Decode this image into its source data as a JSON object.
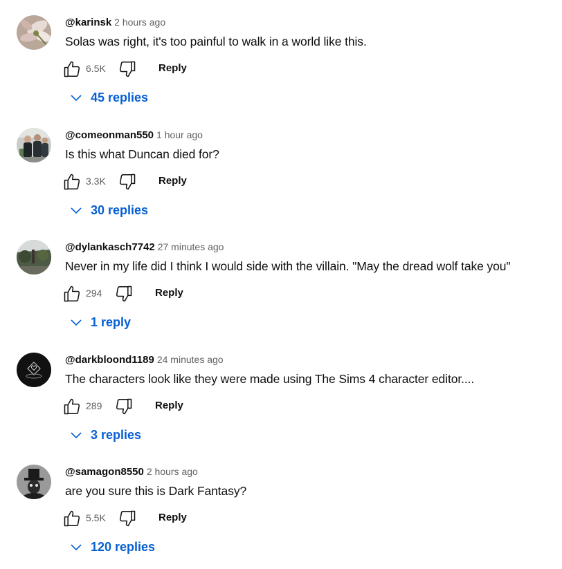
{
  "comments": [
    {
      "author": "@karinsk",
      "time": "2 hours ago",
      "text": "Solas was right, it's too painful to walk in a world like this.",
      "likes": "6.5K",
      "reply_label": "Reply",
      "replies_label": "45 replies",
      "avatar": "flower-avatar"
    },
    {
      "author": "@comeonman550",
      "time": "1 hour ago",
      "text": "Is this what Duncan died for?",
      "likes": "3.3K",
      "reply_label": "Reply",
      "replies_label": "30 replies",
      "avatar": "people-avatar"
    },
    {
      "author": "@dylankasch7742",
      "time": "27 minutes ago",
      "text": "Never in my life did I think I would side with the villain. \"May the dread wolf take you\"",
      "likes": "294",
      "reply_label": "Reply",
      "replies_label": "1 reply",
      "avatar": "outdoor-avatar"
    },
    {
      "author": "@darkbloond1189",
      "time": "24 minutes ago",
      "text": "The characters look like they were made using The Sims 4 character editor....",
      "likes": "289",
      "reply_label": "Reply",
      "replies_label": "3 replies",
      "avatar": "dark-logo-avatar"
    },
    {
      "author": "@samagon8550",
      "time": "2 hours ago",
      "text": "are you sure this is Dark Fantasy?",
      "likes": "5.5K",
      "reply_label": "Reply",
      "replies_label": "120 replies",
      "avatar": "top-hat-avatar"
    }
  ],
  "colors": {
    "link_blue": "#065fd4",
    "secondary_text": "#606060",
    "primary_text": "#0f0f0f"
  },
  "icons": {
    "like": "thumbs-up-icon",
    "dislike": "thumbs-down-icon",
    "expand": "chevron-down-icon"
  }
}
